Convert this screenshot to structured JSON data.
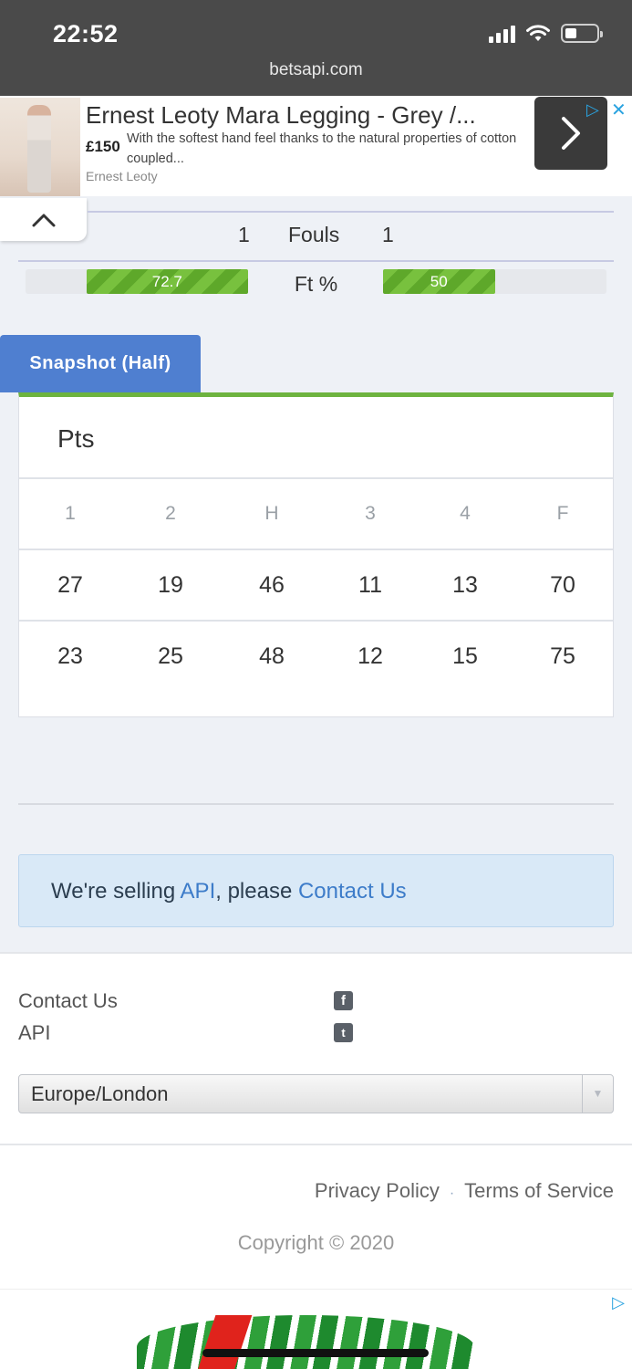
{
  "status_bar": {
    "time": "22:52",
    "url": "betsapi.com"
  },
  "ad_top": {
    "title": "Ernest Leoty Mara Legging - Grey /...",
    "price": "£150",
    "description": "With the softest hand feel thanks to the natural properties of cotton coupled...",
    "brand": "Ernest Leoty",
    "arrow_icon": "chevron-right-icon",
    "choices_icon": "adchoices-icon",
    "close_icon": "close-icon"
  },
  "stats": {
    "fouls": {
      "home": "1",
      "label": "Fouls",
      "away": "1"
    },
    "ft_percent": {
      "label": "Ft %",
      "home": "72.7",
      "away": "50",
      "home_value": 72.7,
      "away_value": 50
    }
  },
  "snapshot": {
    "tab_label": "Snapshot (Half)",
    "title": "Pts",
    "columns": [
      "1",
      "2",
      "H",
      "3",
      "4",
      "F"
    ],
    "rows": [
      [
        "27",
        "19",
        "46",
        "11",
        "13",
        "70"
      ],
      [
        "23",
        "25",
        "48",
        "12",
        "15",
        "75"
      ]
    ]
  },
  "notice": {
    "prefix": "We're selling ",
    "api_link": "API",
    "middle": ", please ",
    "contact_link": "Contact Us"
  },
  "footer": {
    "links": [
      "Contact Us",
      "API"
    ],
    "social_icons": [
      "facebook-icon",
      "twitter-icon"
    ],
    "timezone": "Europe/London",
    "privacy": "Privacy Policy",
    "separator": "·",
    "terms": "Terms of Service",
    "copyright": "Copyright © 2020"
  },
  "colors": {
    "accent_blue": "#4f7fd0",
    "bar_green": "#6db33f",
    "link": "#3d7cc9"
  }
}
